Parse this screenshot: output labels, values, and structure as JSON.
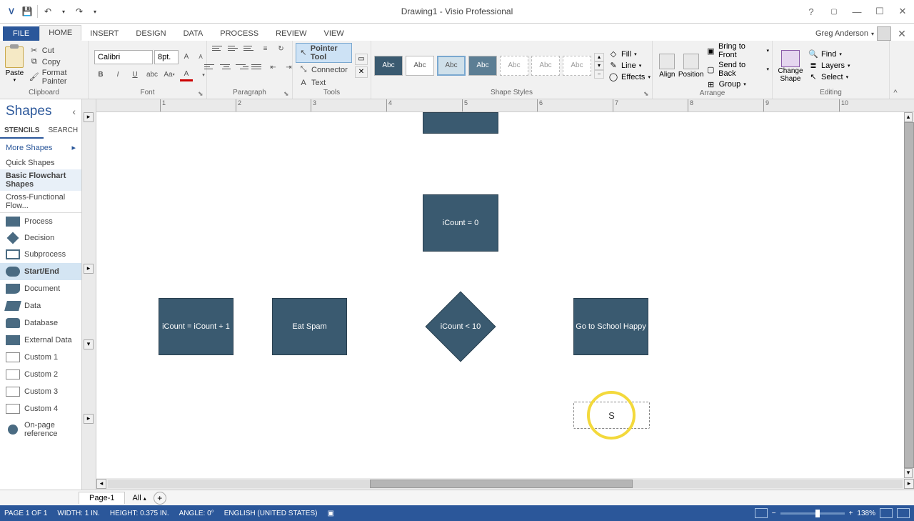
{
  "titlebar": {
    "document": "Drawing1 - Visio Professional"
  },
  "user": {
    "name": "Greg Anderson"
  },
  "tabs": {
    "file": "FILE",
    "items": [
      "HOME",
      "INSERT",
      "DESIGN",
      "DATA",
      "PROCESS",
      "REVIEW",
      "VIEW"
    ],
    "active": 0
  },
  "ribbon": {
    "clipboard": {
      "label": "Clipboard",
      "paste": "Paste",
      "cut": "Cut",
      "copy": "Copy",
      "format_painter": "Format Painter"
    },
    "font": {
      "label": "Font",
      "name": "Calibri",
      "size": "8pt."
    },
    "paragraph": {
      "label": "Paragraph"
    },
    "tools": {
      "label": "Tools",
      "pointer": "Pointer Tool",
      "connector": "Connector",
      "text": "Text"
    },
    "shape_styles": {
      "label": "Shape Styles",
      "swatch_text": "Abc",
      "fill": "Fill",
      "line": "Line",
      "effects": "Effects"
    },
    "arrange": {
      "label": "Arrange",
      "align": "Align",
      "position": "Position",
      "bring_front": "Bring to Front",
      "send_back": "Send to Back",
      "group": "Group"
    },
    "editing": {
      "label": "Editing",
      "change_shape": "Change Shape",
      "find": "Find",
      "layers": "Layers",
      "select": "Select"
    }
  },
  "shapes_panel": {
    "title": "Shapes",
    "tabs": {
      "stencils": "STENCILS",
      "search": "SEARCH"
    },
    "more": "More Shapes",
    "stencils": [
      "Quick Shapes",
      "Basic Flowchart Shapes",
      "Cross-Functional Flow..."
    ],
    "items": [
      "Process",
      "Decision",
      "Subprocess",
      "Start/End",
      "Document",
      "Data",
      "Database",
      "External Data",
      "Custom 1",
      "Custom 2",
      "Custom 3",
      "Custom 4",
      "On-page reference"
    ]
  },
  "canvas": {
    "ruler_ticks": [
      "1",
      "2",
      "3",
      "4",
      "5",
      "6",
      "7",
      "8",
      "9",
      "10"
    ],
    "shapes": {
      "top_rect": "",
      "icount0": "iCount = 0",
      "icount_inc": "iCount = iCount + 1",
      "eat_spam": "Eat Spam",
      "decision": "iCount < 10",
      "school": "Go to School Happy",
      "editing_cursor": "S"
    }
  },
  "page_tabs": {
    "page1": "Page-1",
    "all": "All"
  },
  "status": {
    "page": "PAGE 1 OF 1",
    "width": "WIDTH: 1 IN.",
    "height": "HEIGHT: 0.375 IN.",
    "angle": "ANGLE: 0°",
    "lang": "ENGLISH (UNITED STATES)",
    "zoom": "138%"
  }
}
